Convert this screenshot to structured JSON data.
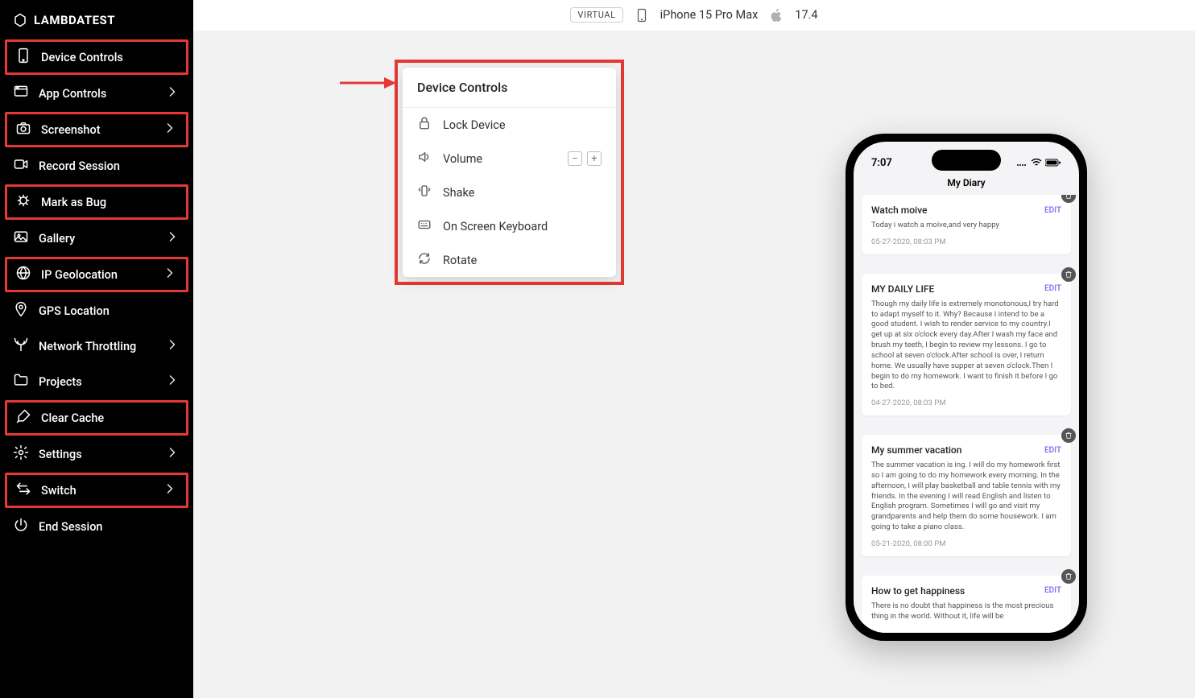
{
  "brand": "LAMBDATEST",
  "topbar": {
    "virtual": "VIRTUAL",
    "device": "iPhone 15 Pro Max",
    "os": "17.4"
  },
  "sidebar": [
    {
      "id": "device-controls",
      "label": "Device Controls",
      "chevron": false,
      "hl": true,
      "icon": "phone"
    },
    {
      "id": "app-controls",
      "label": "App Controls",
      "chevron": true,
      "hl": false,
      "icon": "app"
    },
    {
      "id": "screenshot",
      "label": "Screenshot",
      "chevron": true,
      "hl": true,
      "icon": "camera"
    },
    {
      "id": "record-session",
      "label": "Record Session",
      "chevron": false,
      "hl": false,
      "icon": "video"
    },
    {
      "id": "mark-as-bug",
      "label": "Mark as Bug",
      "chevron": false,
      "hl": true,
      "icon": "bug"
    },
    {
      "id": "gallery",
      "label": "Gallery",
      "chevron": true,
      "hl": false,
      "icon": "gallery"
    },
    {
      "id": "ip-geolocation",
      "label": "IP Geolocation",
      "chevron": true,
      "hl": true,
      "icon": "globe"
    },
    {
      "id": "gps-location",
      "label": "GPS Location",
      "chevron": false,
      "hl": false,
      "icon": "pin"
    },
    {
      "id": "network-throttling",
      "label": "Network Throttling",
      "chevron": true,
      "hl": false,
      "icon": "antenna"
    },
    {
      "id": "projects",
      "label": "Projects",
      "chevron": true,
      "hl": false,
      "icon": "folder"
    },
    {
      "id": "clear-cache",
      "label": "Clear Cache",
      "chevron": false,
      "hl": true,
      "icon": "brush"
    },
    {
      "id": "settings",
      "label": "Settings",
      "chevron": true,
      "hl": false,
      "icon": "gear"
    },
    {
      "id": "switch",
      "label": "Switch",
      "chevron": true,
      "hl": true,
      "icon": "switch"
    },
    {
      "id": "end-session",
      "label": "End Session",
      "chevron": false,
      "hl": false,
      "icon": "power"
    }
  ],
  "panel": {
    "title": "Device Controls",
    "items": [
      {
        "id": "lock-device",
        "label": "Lock Device",
        "icon": "lock"
      },
      {
        "id": "volume",
        "label": "Volume",
        "icon": "volume",
        "volume": true
      },
      {
        "id": "shake",
        "label": "Shake",
        "icon": "shake"
      },
      {
        "id": "on-screen-keyboard",
        "label": "On Screen Keyboard",
        "icon": "keyboard"
      },
      {
        "id": "rotate",
        "label": "Rotate",
        "icon": "rotate"
      }
    ]
  },
  "phone": {
    "time": "7:07",
    "appTitle": "My Diary",
    "edit": "EDIT",
    "entries": [
      {
        "title": "Watch moive",
        "body": "Today i watch a moive,and very happy",
        "date": "05-27-2020, 08:03 PM"
      },
      {
        "title": "MY DAILY LIFE",
        "body": "Though my daily life is extremely monotonous,I try hard to adapt myself to it. Why? Because I intend to be a good student. I wish to render service to my country.I get up at six o'clock every day.After I wash my face and brush my teeth, I begin to review my lessons. I go to school at seven o'clock.After school is over, I return home. We usually have supper at seven o'clock.Then I begin to do my homework. I want to finish it before I go to bed.",
        "date": "04-27-2020, 08:03 PM"
      },
      {
        "title": "My summer vacation",
        "body": "The summer vacation is ing. I will do my homework first so I am going to do my homework every morning. In the afternoon, I will play basketball and table tennis with my friends. In the evening I will read English and listen to English program. Sometimes I will go and visit my grandparents and help them do some housework. I am going to take a piano class.",
        "date": "05-21-2020, 08:00 PM"
      },
      {
        "title": "How to get happiness",
        "body": "There is no doubt that happiness is the most precious thing in the world. Without it, life will be",
        "date": ""
      }
    ]
  }
}
